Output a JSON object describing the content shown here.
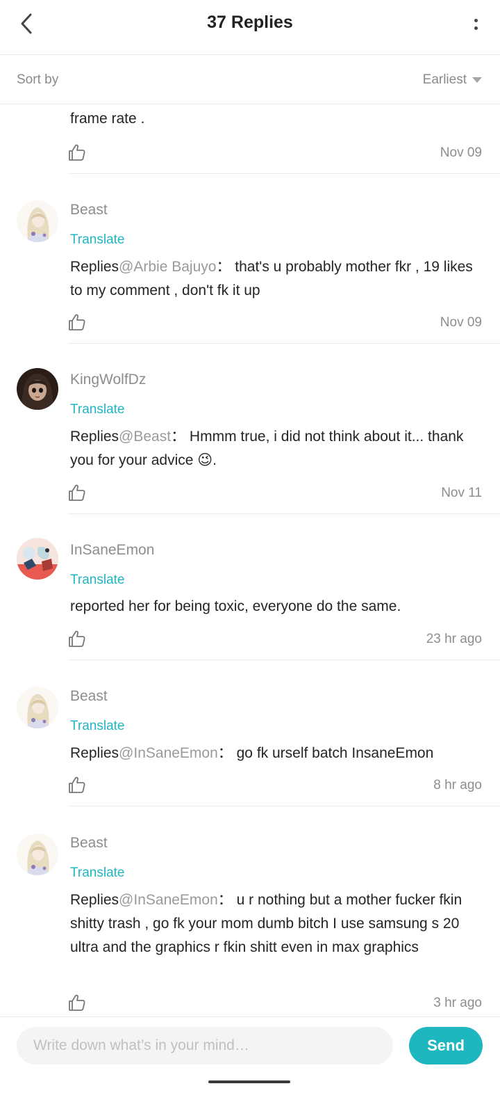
{
  "header": {
    "title": "37 Replies"
  },
  "sort": {
    "label": "Sort by",
    "value": "Earliest"
  },
  "partial_comment": {
    "text": "frame rate .",
    "time": "Nov 09"
  },
  "comments": [
    {
      "user": "Beast",
      "translate": "Translate",
      "prefix": "Replies",
      "mention": "@Arbie Bajuyo",
      "sep": "：",
      "text": "that's u probably mother fkr , 19 likes to my comment , don't fk it up",
      "time": "Nov 09",
      "avatar": "anime-girl-avatar"
    },
    {
      "user": "KingWolfDz",
      "translate": "Translate",
      "prefix": "Replies",
      "mention": "@Beast",
      "sep": "：",
      "text": "Hmmm true, i did not think about it... thank you for your advice 😉.",
      "time": "Nov 11",
      "avatar": "dark-hair-doll-avatar"
    },
    {
      "user": "InSaneEmon",
      "translate": "Translate",
      "prefix": "",
      "mention": "",
      "sep": "",
      "text": "reported her for being toxic, everyone do the same.",
      "time": "23 hr ago",
      "avatar": "colorful-art-avatar"
    },
    {
      "user": "Beast",
      "translate": "Translate",
      "prefix": "Replies",
      "mention": "@InSaneEmon",
      "sep": "：",
      "text": "go fk urself batch InsaneEmon",
      "time": "8 hr ago",
      "avatar": "anime-girl-avatar"
    },
    {
      "user": "Beast",
      "translate": "Translate",
      "prefix": "Replies",
      "mention": "@InSaneEmon",
      "sep": "：",
      "text": "u r nothing but a mother fucker fkin shitty trash , go fk your mom dumb bitch I use samsung s 20 ultra and the graphics r fkin shitt even in max graphics",
      "time": "3 hr ago",
      "avatar": "anime-girl-avatar"
    }
  ],
  "composer": {
    "placeholder": "Write down what’s in your mind…",
    "send_label": "Send"
  },
  "colors": {
    "accent": "#1eb7bf",
    "translate": "#1fb6c1"
  }
}
